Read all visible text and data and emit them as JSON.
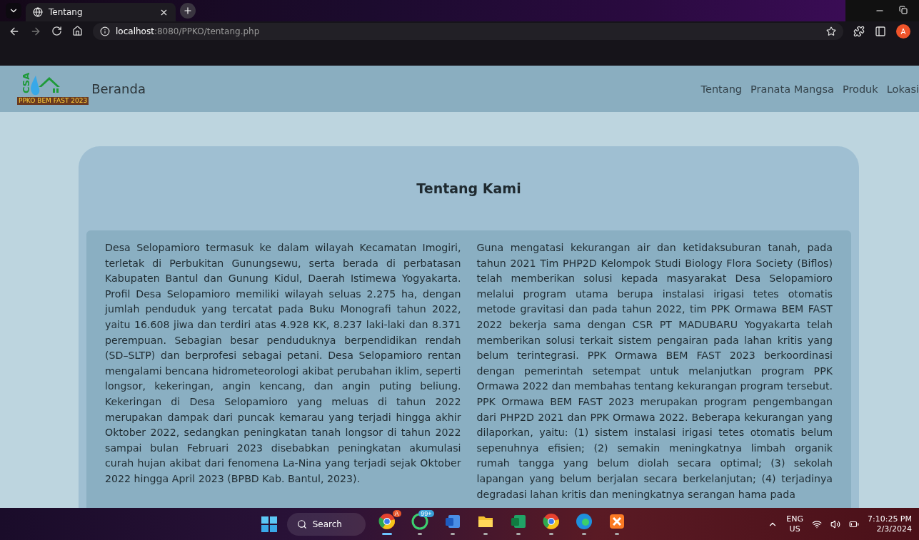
{
  "browser": {
    "tab_title": "Tentang",
    "url_host": "localhost",
    "url_path": ":8080/PPKO/tentang.php",
    "profile": "A"
  },
  "navbar": {
    "logo": {
      "mark": "CSA",
      "caption": "PPKO BEM FAST 2023"
    },
    "brand": "Beranda",
    "links": [
      {
        "label": "Tentang"
      },
      {
        "label": "Pranata Mangsa"
      },
      {
        "label": "Produk"
      },
      {
        "label": "Lokasi"
      }
    ]
  },
  "page": {
    "title": "Tentang Kami",
    "paragraphs": [
      "Desa Selopamioro termasuk ke dalam wilayah Kecamatan Imogiri, terletak di Perbukitan Gunungsewu, serta berada di perbatasan Kabupaten Bantul dan Gunung Kidul, Daerah Istimewa Yogyakarta. Profil Desa Selopamioro memiliki wilayah seluas 2.275 ha, dengan jumlah penduduk yang tercatat pada Buku Monografi tahun 2022, yaitu 16.608 jiwa dan terdiri atas 4.928 KK, 8.237 laki-laki dan 8.371 perempuan. Sebagian besar penduduknya berpendidikan rendah (SD–SLTP) dan berprofesi sebagai petani. Desa Selopamioro rentan mengalami bencana hidrometeorologi akibat perubahan iklim, seperti longsor, kekeringan, angin kencang, dan angin puting beliung. Kekeringan di Desa Selopamioro yang meluas di tahun 2022 merupakan dampak dari puncak kemarau yang terjadi hingga akhir Oktober 2022, sedangkan peningkatan tanah longsor di tahun 2022 sampai bulan Februari 2023 disebabkan peningkatan akumulasi curah hujan akibat dari fenomena La-Nina yang terjadi sejak Oktober 2022 hingga April 2023 (BPBD Kab. Bantul, 2023).",
      "Guna mengatasi kekurangan air dan ketidaksuburan tanah, pada tahun 2021 Tim PHP2D Kelompok Studi Biology Flora Society (Biflos) telah memberikan solusi kepada masyarakat Desa Selopamioro melalui program utama berupa instalasi irigasi tetes otomatis metode gravitasi dan pada tahun 2022, tim PPK Ormawa BEM FAST 2022 bekerja sama dengan CSR PT MADUBARU Yogyakarta telah memberikan solusi terkait sistem pengairan pada lahan kritis yang belum terintegrasi. PPK Ormawa BEM FAST 2023 berkoordinasi dengan pemerintah setempat untuk melanjutkan program PPK Ormawa 2022 dan membahas tentang kekurangan program tersebut. PPK Ormawa BEM FAST 2023 merupakan program pengembangan dari PHP2D 2021 dan PPK Ormawa 2022. Beberapa kekurangan yang dilaporkan, yaitu: (1) sistem instalasi irigasi tetes otomatis belum sepenuhnya efisien; (2) semakin meningkatnya limbah organik rumah tangga yang belum diolah secara optimal; (3) sekolah lapangan yang belum berjalan secara berkelanjutan; (4) terjadinya degradasi lahan kritis dan meningkatnya serangan hama pada"
    ]
  },
  "taskbar": {
    "search": "Search",
    "apps": [
      {
        "kind": "chrome",
        "badge": "A",
        "active": true
      },
      {
        "kind": "whatsapp",
        "badge": "99+",
        "active": false
      },
      {
        "kind": "word",
        "active": false
      },
      {
        "kind": "folder",
        "active": false
      },
      {
        "kind": "excel",
        "active": false
      },
      {
        "kind": "chrome",
        "active": false
      },
      {
        "kind": "edge",
        "active": false
      },
      {
        "kind": "xampp",
        "active": false
      }
    ],
    "language": "ENG",
    "region": "US",
    "time": "7:10:25 PM",
    "date": "2/3/2024"
  }
}
